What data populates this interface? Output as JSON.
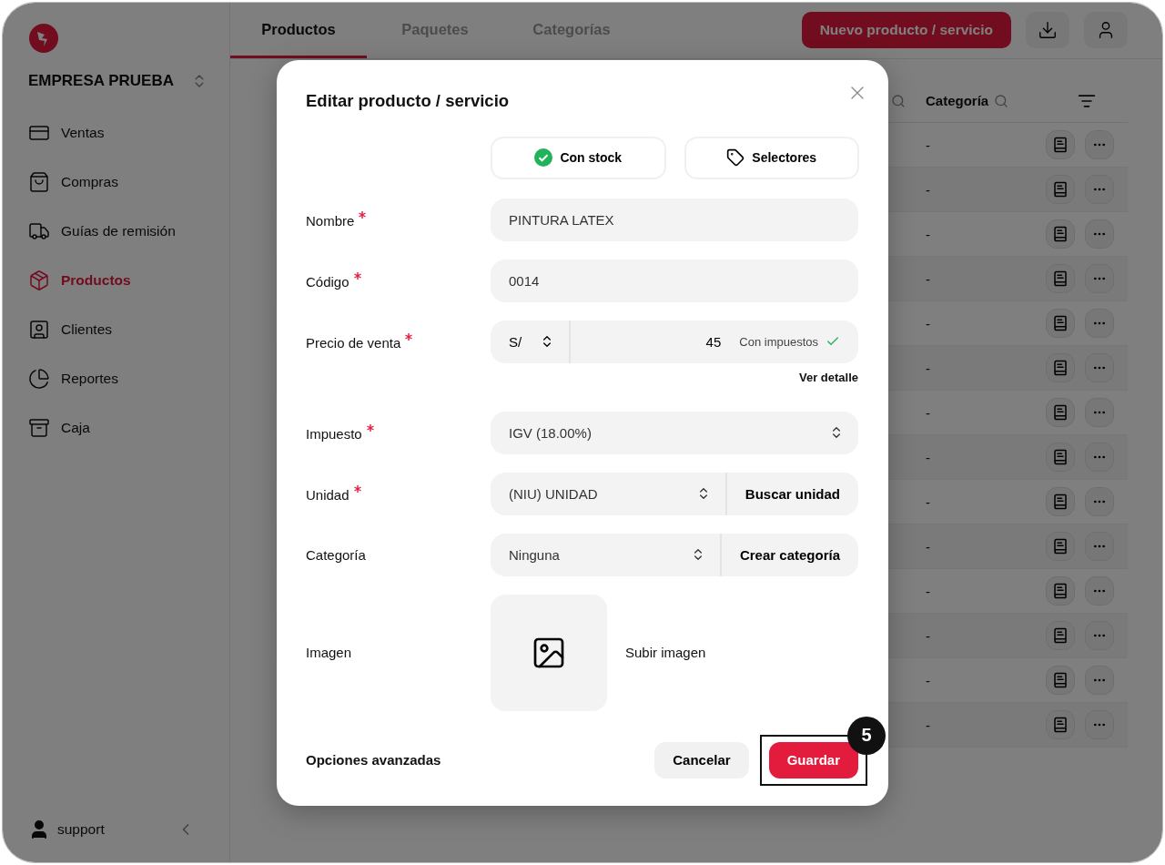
{
  "sidebar": {
    "company": "EMPRESA PRUEBA",
    "items": [
      {
        "label": "Ventas",
        "selected": false
      },
      {
        "label": "Compras",
        "selected": false
      },
      {
        "label": "Guías de remisión",
        "selected": false
      },
      {
        "label": "Productos",
        "selected": true
      },
      {
        "label": "Clientes",
        "selected": false
      },
      {
        "label": "Reportes",
        "selected": false
      },
      {
        "label": "Caja",
        "selected": false
      }
    ],
    "user": "support"
  },
  "tabs": [
    {
      "label": "Productos",
      "selected": true
    },
    {
      "label": "Paquetes",
      "selected": false
    },
    {
      "label": "Categorías",
      "selected": false
    }
  ],
  "header": {
    "new_button": "Nuevo producto / servicio"
  },
  "table": {
    "columns": [
      "Categoría"
    ],
    "rows": [
      {
        "categoria": "-"
      },
      {
        "categoria": "-"
      },
      {
        "categoria": "-"
      },
      {
        "categoria": "-"
      },
      {
        "categoria": "-"
      },
      {
        "categoria": "-"
      },
      {
        "categoria": "-"
      },
      {
        "categoria": "-"
      },
      {
        "categoria": "-"
      },
      {
        "categoria": "-"
      },
      {
        "categoria": "-"
      },
      {
        "categoria": "-"
      },
      {
        "categoria": "-"
      },
      {
        "categoria": "-"
      }
    ]
  },
  "modal": {
    "title": "Editar producto / servicio",
    "toggles": [
      {
        "kind": "stock",
        "label": "Con stock",
        "checked": true
      },
      {
        "kind": "selectors",
        "label": "Selectores"
      }
    ],
    "fields": [
      {
        "kind": "text",
        "label": "Nombre",
        "required": true,
        "value": "PINTURA LATEX"
      },
      {
        "kind": "text",
        "label": "Código",
        "required": true,
        "value": "0014"
      },
      {
        "kind": "price",
        "label": "Precio de venta",
        "required": true,
        "currency": "S/",
        "value": "45",
        "tax_note": "Con impuestos",
        "tax_included": true,
        "link": "Ver detalle"
      },
      {
        "kind": "select",
        "label": "Impuesto",
        "required": true,
        "value": "IGV (18.00%)"
      },
      {
        "kind": "select_action",
        "label": "Unidad",
        "required": true,
        "value": "(NIU) UNIDAD",
        "action": "Buscar unidad"
      },
      {
        "kind": "select_action",
        "label": "Categoría",
        "required": false,
        "value": "Ninguna",
        "action": "Crear categoría"
      },
      {
        "kind": "image",
        "label": "Imagen",
        "action": "Subir imagen"
      }
    ],
    "advanced": "Opciones avanzadas",
    "cancel": "Cancelar",
    "save": "Guardar",
    "step": "5"
  }
}
